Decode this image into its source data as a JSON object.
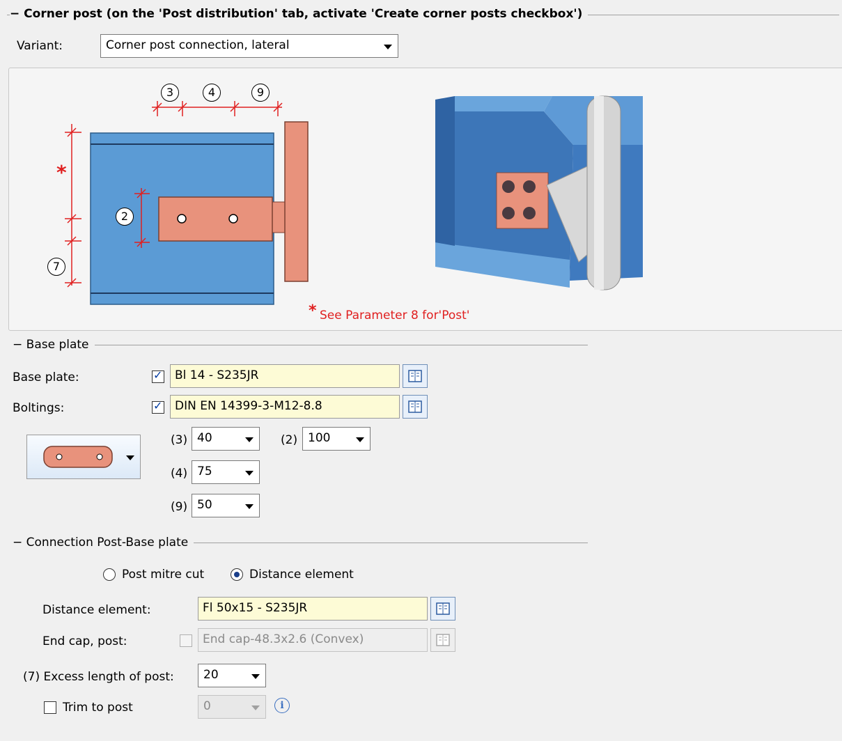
{
  "corner_post": {
    "title": "Corner post (on the 'Post distribution' tab, activate 'Create corner posts checkbox')",
    "variant_label": "Variant:",
    "variant_value": "Corner post connection, lateral"
  },
  "diagram": {
    "labels": {
      "d3": "3",
      "d4": "4",
      "d9": "9",
      "d2": "2",
      "d7": "7",
      "star": "*"
    },
    "note": "See Parameter 8 for'Post'"
  },
  "base_plate_group": {
    "title": "Base plate",
    "base_plate_label": "Base plate:",
    "base_plate_checked": true,
    "base_plate_value": "Bl 14 - S235JR",
    "boltings_label": "Boltings:",
    "boltings_checked": true,
    "boltings_value": "DIN EN 14399-3-M12-8.8",
    "params": [
      {
        "id": "(3)",
        "value": "40"
      },
      {
        "id": "(2)",
        "value": "100"
      },
      {
        "id": "(4)",
        "value": "75"
      },
      {
        "id": "(9)",
        "value": "50"
      }
    ]
  },
  "connection_group": {
    "title": "Connection Post-Base plate",
    "radio_mitre": "Post mitre cut",
    "radio_distance": "Distance element",
    "selected": "Distance element",
    "distance_label": "Distance element:",
    "distance_value": "Fl 50x15 - S235JR",
    "endcap_label": "End cap, post:",
    "endcap_checked": false,
    "endcap_value": "End cap-48.3x2.6 (Convex)",
    "excess_label": "(7) Excess length of post:",
    "excess_value": "20",
    "trim_label": "Trim to post",
    "trim_checked": false,
    "trim_value": "0"
  },
  "colors": {
    "background": "#f0f0f0",
    "input_yellow": "#fdfbd6",
    "beam_blue": "#5b9bd5",
    "plate_salmon": "#e8927c",
    "dimension_red": "#e02020"
  }
}
